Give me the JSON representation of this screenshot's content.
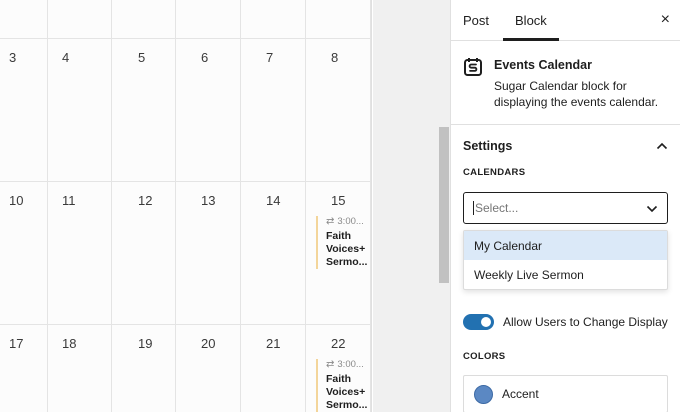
{
  "calendar": {
    "rows": [
      {
        "days": [
          "",
          "",
          "",
          "",
          "",
          "",
          ""
        ]
      },
      {
        "days": [
          "3",
          "4",
          "5",
          "6",
          "7",
          "8",
          ""
        ]
      },
      {
        "days": [
          "10",
          "11",
          "12",
          "13",
          "14",
          "15",
          ""
        ]
      },
      {
        "days": [
          "17",
          "18",
          "19",
          "20",
          "21",
          "22",
          ""
        ]
      }
    ],
    "events": [
      {
        "time": "3:00...",
        "title": "Faith Voices+ Sermo..."
      },
      {
        "time": "3:00...",
        "title": "Faith Voices+ Sermo..."
      }
    ]
  },
  "sidebar": {
    "tabs": [
      {
        "label": "Post"
      },
      {
        "label": "Block"
      }
    ],
    "close_label": "×",
    "block": {
      "icon": "calendar-block-icon",
      "title": "Events Calendar",
      "description": "Sugar Calendar block for displaying the events calendar."
    },
    "settings": {
      "title": "Settings",
      "calendars_label": "CALENDARS",
      "select_placeholder": "Select...",
      "options": [
        {
          "label": "My Calendar"
        },
        {
          "label": "Weekly Live Sermon"
        }
      ],
      "toggle_label": "Allow Users to Change Display",
      "toggle_on": true,
      "colors_label": "COLORS",
      "colors": [
        {
          "name": "Accent",
          "value": "#5b88c3"
        }
      ]
    }
  },
  "theme": {
    "accent": "#2271b1",
    "highlight": "#dbe9f8",
    "event_bar": "#f3d59a"
  }
}
